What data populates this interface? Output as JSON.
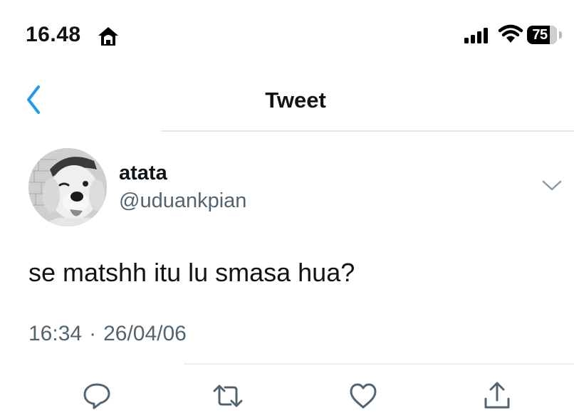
{
  "status_bar": {
    "time": "16.48",
    "battery_level": "75",
    "icons": [
      "home-icon",
      "cellular-signal-icon",
      "wifi-icon",
      "battery-icon"
    ]
  },
  "header": {
    "title": "Tweet",
    "back_icon": "chevron-left-icon"
  },
  "tweet": {
    "author": {
      "display_name": "atata",
      "handle": "@uduankpian",
      "avatar": "dog-avatar"
    },
    "text": "se matshh itu lu smasa hua?",
    "time": "16:34",
    "separator": "·",
    "date": "26/04/06"
  },
  "actions": [
    {
      "name": "reply",
      "icon": "reply-icon"
    },
    {
      "name": "retweet",
      "icon": "retweet-icon"
    },
    {
      "name": "like",
      "icon": "like-icon"
    },
    {
      "name": "share",
      "icon": "share-icon"
    }
  ],
  "colors": {
    "accent": "#1d9bf0",
    "text_primary": "#0f1419",
    "text_secondary": "#536471",
    "divider": "#e6e6e6"
  }
}
